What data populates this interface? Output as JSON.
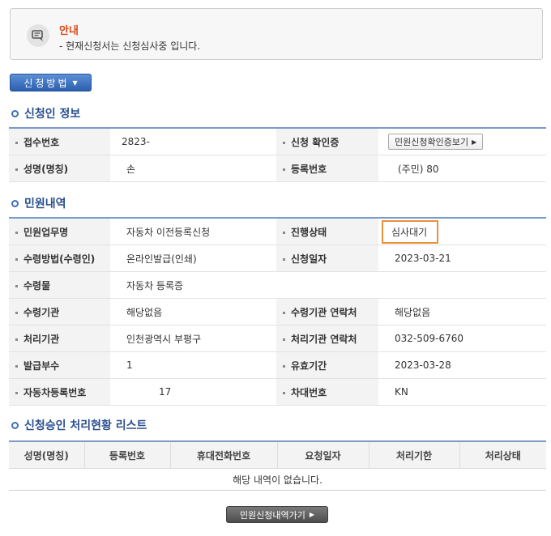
{
  "notice": {
    "title": "안내",
    "message": "- 현재신청서는 신청심사중 입니다."
  },
  "method_button": {
    "label": "신청방법"
  },
  "applicant_section": {
    "title": "신청인 정보",
    "receipt_no_label": "접수번호",
    "receipt_no_value": "2823-",
    "confirm_label": "신청 확인증",
    "confirm_button": "민원신청확인증보기",
    "name_label": "성명(명칭)",
    "name_value": "손",
    "reg_no_label": "등록번호",
    "reg_no_value": "(주민) 80"
  },
  "petition_section": {
    "title": "민원내역",
    "rows": [
      {
        "l1": "민원업무명",
        "v1": "자동차 이전등록신청",
        "l2": "진행상태",
        "v2": "심사대기"
      },
      {
        "l1": "수령방법(수령인)",
        "v1": "온라인발급(인쇄)",
        "l2": "신청일자",
        "v2": "2023-03-21"
      },
      {
        "l1": "수령물",
        "v1": "자동차 등록증"
      },
      {
        "l1": "수령기관",
        "v1": "해당없음",
        "l2": "수령기관 연락처",
        "v2": "해당없음"
      },
      {
        "l1": "처리기관",
        "v1": "인천광역시 부평구",
        "l2": "처리기관 연락처",
        "v2": "032-509-6760"
      },
      {
        "l1": "발급부수",
        "v1": "1",
        "l2": "유효기간",
        "v2": "2023-03-28"
      },
      {
        "l1": "자동차등록번호",
        "v1": "17",
        "l2": "차대번호",
        "v2": "KN"
      }
    ]
  },
  "approval_section": {
    "title": "신청승인 처리현황 리스트",
    "columns": [
      "성명(명칭)",
      "등록번호",
      "휴대전화번호",
      "요청일자",
      "처리기한",
      "처리상태"
    ],
    "empty_message": "해당 내역이 없습니다."
  },
  "back_button": {
    "label": "민원신청내역가기"
  },
  "colors": {
    "accent": "#2c5fae",
    "highlight": "#e8913a",
    "notice_title": "#d9491a"
  }
}
